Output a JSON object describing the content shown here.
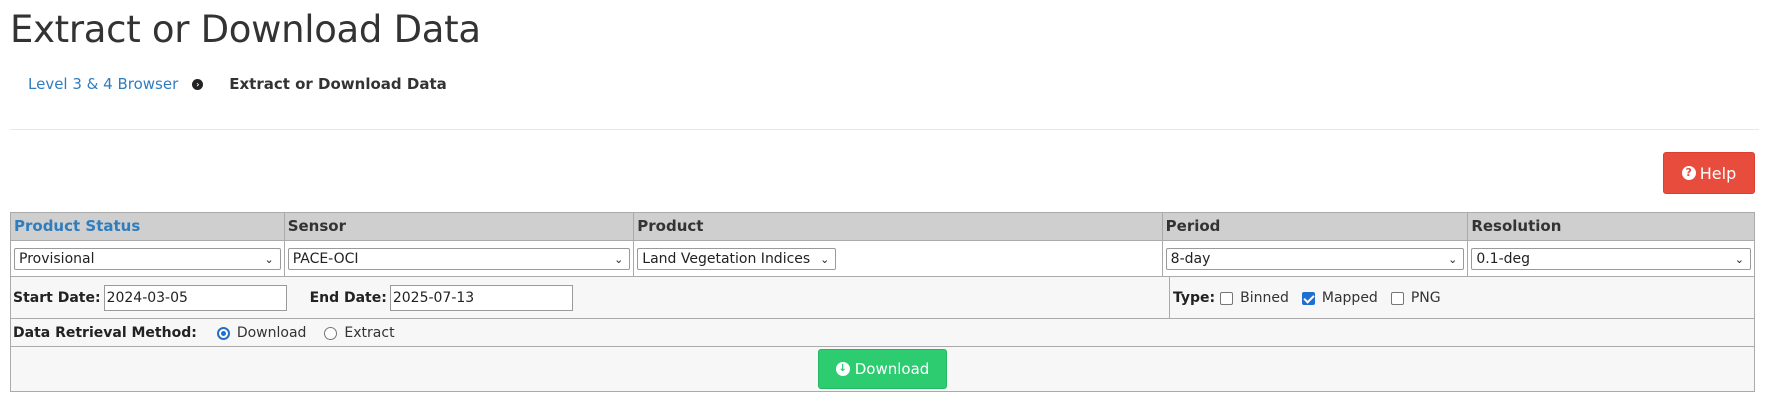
{
  "page": {
    "title": "Extract or Download Data"
  },
  "breadcrumb": {
    "items": [
      {
        "label": "Level 3 & 4 Browser"
      },
      {
        "label": "Extract or Download Data"
      }
    ],
    "separator_icon": "chevron-circle-right-icon"
  },
  "help_button": {
    "icon": "question-circle-icon",
    "label": "Help",
    "color": "#e74c3c"
  },
  "form": {
    "headers": [
      "Product Status",
      "Sensor",
      "Product",
      "Period",
      "Resolution"
    ],
    "selects": {
      "product_status": "Provisional",
      "sensor": "PACE-OCI",
      "product": "Land Vegetation Indices",
      "period": "8-day",
      "resolution": "0.1-deg"
    },
    "start_date_label": "Start Date:",
    "start_date_value": "2024-03-05",
    "end_date_label": "End Date:",
    "end_date_value": "2025-07-13",
    "type_label": "Type:",
    "type_options": [
      {
        "label": "Binned",
        "checked": false
      },
      {
        "label": "Mapped",
        "checked": true
      },
      {
        "label": "PNG",
        "checked": false
      }
    ],
    "method_label": "Data Retrieval Method:",
    "method_options": [
      {
        "label": "Download",
        "selected": true
      },
      {
        "label": "Extract",
        "selected": false
      }
    ]
  },
  "download_button": {
    "icon": "arrow-circle-down-icon",
    "label": "Download",
    "color": "#2ecc71"
  },
  "colors": {
    "link": "#2f7dbf",
    "header_bg": "#cfcfcf",
    "accent_blue": "#1f6fd0"
  }
}
